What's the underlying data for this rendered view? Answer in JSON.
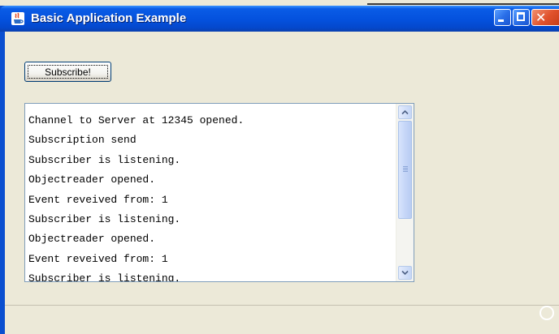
{
  "window": {
    "title": "Basic Application Example",
    "controls": {
      "minimize_icon": "minimize-icon",
      "maximize_icon": "maximize-icon",
      "close_icon": "close-icon"
    }
  },
  "toolbar": {
    "subscribe_label": "Subscribe!"
  },
  "log": {
    "lines": [
      "Channel to Server at 12345 opened.",
      "Subscription send",
      "Subscriber is listening.",
      "Objectreader opened.",
      "Event reveived from: 1",
      "Subscriber is listening.",
      "Objectreader opened.",
      "Event reveived from: 1",
      "Subscriber is listening."
    ]
  },
  "colors": {
    "titlebar": "#0451dd",
    "window_bg": "#ece9d8",
    "close_button": "#e0512b"
  }
}
